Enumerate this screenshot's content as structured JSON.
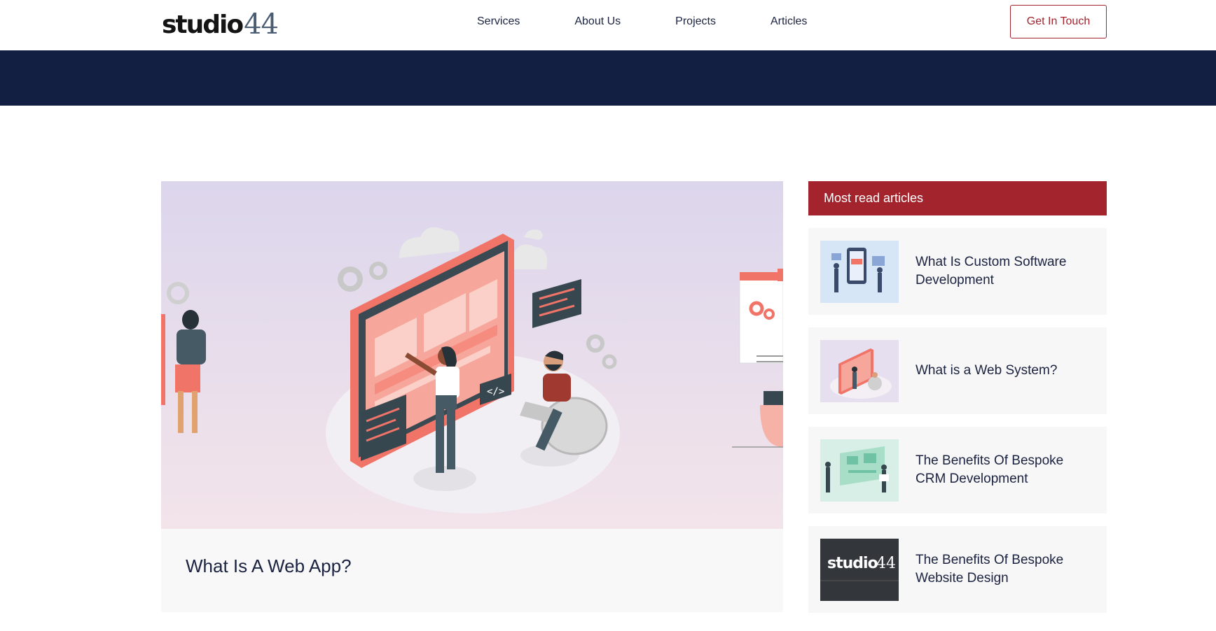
{
  "header": {
    "logo_word": "studio",
    "logo_number": "44",
    "nav": [
      "Services",
      "About Us",
      "Projects",
      "Articles"
    ],
    "cta_label": "Get In Touch"
  },
  "main_article": {
    "title": "What Is A Web App?",
    "image_icon": "web-app-illustration"
  },
  "sidebar": {
    "heading": "Most read articles",
    "items": [
      {
        "title": "What Is Custom Software Development",
        "thumb_icon": "software-illustration"
      },
      {
        "title": "What is a Web System?",
        "thumb_icon": "web-system-illustration"
      },
      {
        "title": "The Benefits Of Bespoke CRM Development",
        "thumb_icon": "crm-illustration"
      },
      {
        "title": "The Benefits Of Bespoke Website Design",
        "thumb_icon": "studio44-logo-thumb"
      }
    ],
    "logo_thumb_word": "studio",
    "logo_thumb_number": "44"
  },
  "colors": {
    "brand_red": "#a3242c",
    "navy": "#121e42",
    "card_bg": "#f7f7f7"
  }
}
